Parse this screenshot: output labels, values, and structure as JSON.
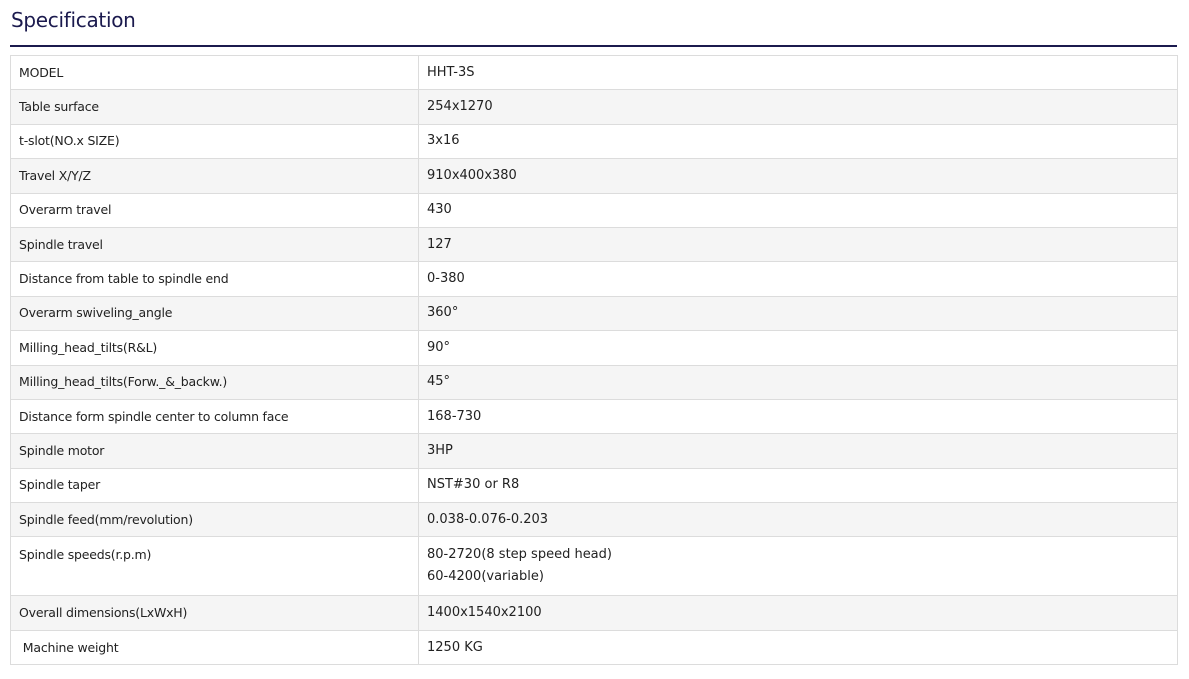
{
  "section": {
    "title": "Specification"
  },
  "spec": {
    "rows": [
      {
        "label": "MODEL",
        "value": "HHT-3S"
      },
      {
        "label": "Table surface",
        "value": "254x1270"
      },
      {
        "label": "t-slot(NO.x SIZE)",
        "value": "3x16"
      },
      {
        "label": "Travel X/Y/Z",
        "value": "910x400x380"
      },
      {
        "label": "Overarm travel",
        "value": "430"
      },
      {
        "label": "Spindle travel",
        "value": "127"
      },
      {
        "label": "Distance from table to spindle end",
        "value": "0-380"
      },
      {
        "label": "Overarm swiveling_angle",
        "value": "360°"
      },
      {
        "label": "Milling_head_tilts(R&L)",
        "value": "90°"
      },
      {
        "label": "Milling_head_tilts(Forw._&_backw.)",
        "value": "45°"
      },
      {
        "label": "Distance form spindle center to column face",
        "value": "168-730"
      },
      {
        "label": "Spindle motor",
        "value": "3HP"
      },
      {
        "label": "Spindle taper",
        "value": "NST#30 or R8"
      },
      {
        "label": "Spindle feed(mm/revolution)",
        "value": "0.038-0.076-0.203"
      },
      {
        "label": "Spindle speeds(r.p.m)",
        "value": "80-2720(8 step speed head)",
        "value2": "60-4200(variable)"
      },
      {
        "label": "Overall dimensions(LxWxH)",
        "value": "1400x1540x2100"
      },
      {
        "label": " Machine weight",
        "value": "1250 KG"
      }
    ]
  }
}
